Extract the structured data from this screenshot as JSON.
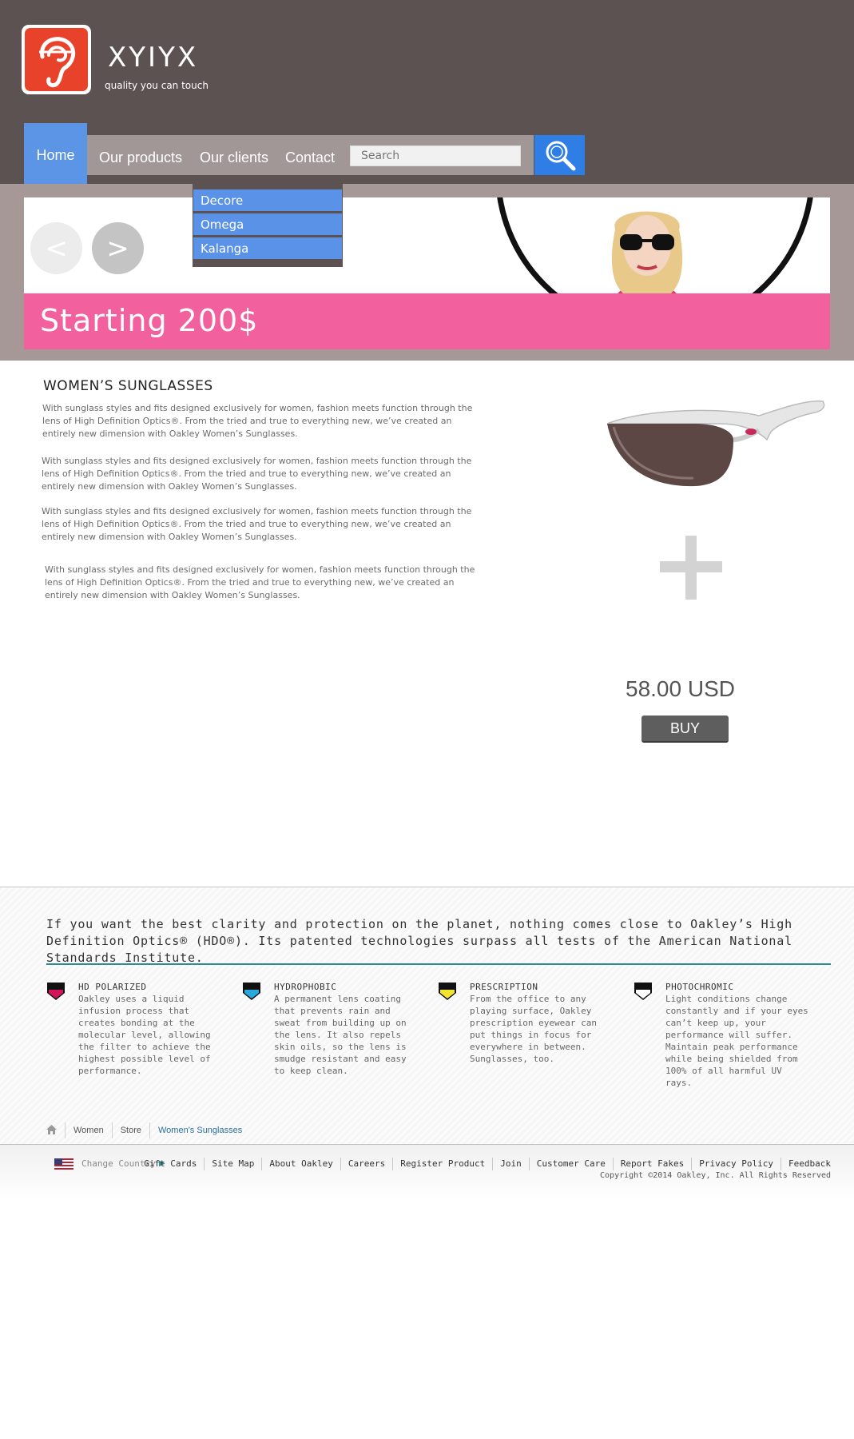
{
  "brand": {
    "name": "XYIYX",
    "tagline": "quality you can touch"
  },
  "nav": {
    "home": "Home",
    "items": [
      "Our products",
      "Our clients",
      "Contact"
    ],
    "search_placeholder": "Search",
    "dropdown": [
      "Decore",
      "Omega",
      "Kalanga"
    ]
  },
  "banner": {
    "text": "Starting 200$",
    "prev": "<",
    "next": ">"
  },
  "main": {
    "title": "WOMEN’S SUNGLASSES",
    "paragraphs": [
      "With sunglass styles and fits designed exclusively for women, fashion meets function through the lens of High Definition Optics®. From the tried and true to everything new, we’ve created an entirely new dimension with Oakley Women’s Sunglasses.",
      "With sunglass styles and fits designed exclusively for women, fashion meets function through the lens of High Definition Optics®. From the tried and true to everything new, we’ve created an entirely new dimension with Oakley Women’s Sunglasses.",
      "With sunglass styles and fits designed exclusively for women, fashion meets function through the lens of High Definition Optics®. From the tried and true to everything new, we’ve created an entirely new dimension with Oakley Women’s Sunglasses.",
      "With sunglass styles and fits designed exclusively for women, fashion meets function through the lens of High Definition Optics®. From the tried and true to everything new, we’ve created an entirely new dimension with Oakley Women’s Sunglasses."
    ],
    "price": "58.00 USD",
    "buy": "BUY"
  },
  "footer": {
    "intro": "If you want the best clarity and protection on the planet, nothing comes close to Oakley’s High Definition Optics® (HDO®). Its patented technologies surpass all tests of the American National Standards Institute.",
    "features": [
      {
        "title": "HD POLARIZED",
        "body": "Oakley uses a liquid infusion process that creates bonding at the molecular level, allowing the filter to achieve the highest possible level of performance.",
        "icon": "hd-polarized-icon",
        "color": "#d4145a"
      },
      {
        "title": "HYDROPHOBIC",
        "body": "A permanent lens coating that prevents rain and sweat from building up on the lens. It also repels skin oils, so the lens is smudge resistant and easy to keep clean.",
        "icon": "hydrophobic-icon",
        "color": "#29a8e0"
      },
      {
        "title": "PRESCRIPTION",
        "body": "From the office to any playing surface, Oakley prescription eyewear can put things in focus for everywhere in between. Sunglasses, too.",
        "icon": "prescription-icon",
        "color": "#f5e52a"
      },
      {
        "title": "PHOTOCHROMIC",
        "body": "Light conditions change constantly and if your eyes can’t keep up, your performance will suffer. Maintain peak performance while being shielded from 100% of all harmful UV rays.",
        "icon": "photochromic-icon",
        "color": "#ffffff"
      }
    ],
    "breadcrumbs": [
      "Women",
      "Store",
      "Women's Sunglasses"
    ],
    "change_country": "Change Country",
    "links": [
      "Gift Cards",
      "Site Map",
      "About Oakley",
      "Careers",
      "Register Product",
      "Join",
      "Customer Care",
      "Report Fakes",
      "Privacy Policy",
      "Feedback"
    ],
    "copyright": "Copyright ©2014 Oakley, Inc. All Rights Reserved"
  }
}
